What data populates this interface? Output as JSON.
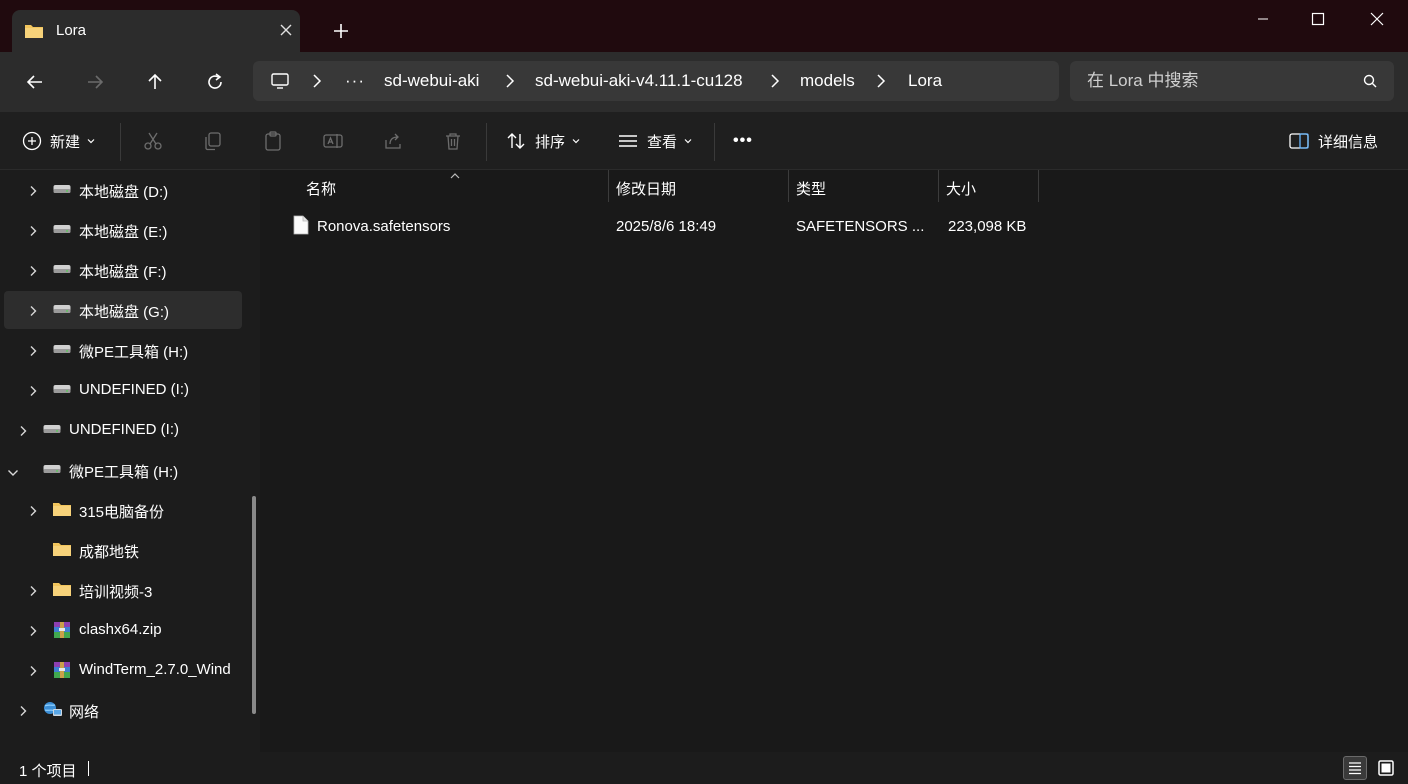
{
  "window": {
    "tab_title": "Lora",
    "tab_icon": "folder-icon",
    "buttons": [
      "minimize",
      "maximize",
      "close"
    ]
  },
  "nav": {
    "breadcrumb": [
      "sd-webui-aki",
      "sd-webui-aki-v4.11.1-cu128",
      "models",
      "Lora"
    ],
    "overflow": "···",
    "search_placeholder": "在 Lora 中搜索"
  },
  "toolbar": {
    "new_label": "新建",
    "sort_label": "排序",
    "view_label": "查看",
    "more_label": "•••",
    "details_label": "详细信息"
  },
  "sidebar": {
    "items": [
      {
        "label": "本地磁盘 (D:)",
        "icon": "drive-icon",
        "indent": 1,
        "expand": "collapsed",
        "selected": false
      },
      {
        "label": "本地磁盘 (E:)",
        "icon": "drive-icon",
        "indent": 1,
        "expand": "collapsed",
        "selected": false
      },
      {
        "label": "本地磁盘 (F:)",
        "icon": "drive-icon",
        "indent": 1,
        "expand": "collapsed",
        "selected": false
      },
      {
        "label": "本地磁盘 (G:)",
        "icon": "drive-icon",
        "indent": 1,
        "expand": "collapsed",
        "selected": true
      },
      {
        "label": "微PE工具箱 (H:)",
        "icon": "drive-icon",
        "indent": 1,
        "expand": "collapsed",
        "selected": false
      },
      {
        "label": "UNDEFINED (I:)",
        "icon": "drive-icon",
        "indent": 1,
        "expand": "collapsed",
        "selected": false
      },
      {
        "label": "UNDEFINED (I:)",
        "icon": "drive-icon",
        "indent": 0,
        "expand": "collapsed",
        "selected": false
      },
      {
        "label": "微PE工具箱 (H:)",
        "icon": "drive-icon",
        "indent": 0,
        "expand": "expanded",
        "selected": false
      },
      {
        "label": "315电脑备份",
        "icon": "folder-icon",
        "indent": 1,
        "expand": "collapsed",
        "selected": false
      },
      {
        "label": "成都地铁",
        "icon": "folder-icon",
        "indent": 1,
        "expand": "none",
        "selected": false
      },
      {
        "label": "培训视频-3",
        "icon": "folder-icon",
        "indent": 1,
        "expand": "collapsed",
        "selected": false
      },
      {
        "label": "clashx64.zip",
        "icon": "archive-icon",
        "indent": 1,
        "expand": "collapsed",
        "selected": false
      },
      {
        "label": "WindTerm_2.7.0_Wind",
        "icon": "archive-icon",
        "indent": 1,
        "expand": "collapsed",
        "selected": false
      },
      {
        "label": "网络",
        "icon": "network-icon",
        "indent": 0,
        "expand": "collapsed",
        "selected": false
      }
    ]
  },
  "columns": [
    "名称",
    "修改日期",
    "类型",
    "大小"
  ],
  "files": [
    {
      "name": "Ronova.safetensors",
      "modified": "2025/8/6 18:49",
      "type": "SAFETENSORS ...",
      "size": "223,098 KB",
      "icon": "file-icon"
    }
  ],
  "status": {
    "count_text": "1 个项目"
  },
  "colors": {
    "titlebar": "#200a0e",
    "background": "#191919",
    "folder": "#f2c55c"
  }
}
